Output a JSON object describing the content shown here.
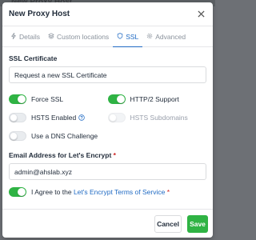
{
  "background": {
    "title_fragment": "New Proxy Host"
  },
  "modal": {
    "title": "New Proxy Host",
    "tabs": [
      {
        "label": "Details",
        "icon": "zap-icon",
        "active": false
      },
      {
        "label": "Custom locations",
        "icon": "layers-icon",
        "active": false
      },
      {
        "label": "SSL",
        "icon": "shield-icon",
        "active": true
      },
      {
        "label": "Advanced",
        "icon": "gear-icon",
        "active": false
      }
    ],
    "ssl_certificate": {
      "label": "SSL Certificate",
      "selected": "Request a new SSL Certificate"
    },
    "toggles": {
      "force_ssl": {
        "label": "Force SSL",
        "on": true
      },
      "http2": {
        "label": "HTTP/2 Support",
        "on": true
      },
      "hsts": {
        "label": "HSTS Enabled",
        "on": false
      },
      "hsts_subdomains": {
        "label": "HSTS Subdomains",
        "on": false,
        "disabled": true
      },
      "dns_challenge": {
        "label": "Use a DNS Challenge",
        "on": false
      }
    },
    "email": {
      "label": "Email Address for Let's Encrypt",
      "required_mark": "*",
      "value": "admin@ahslab.xyz"
    },
    "agree": {
      "prefix": "I Agree to the",
      "link": "Let's Encrypt Terms of Service",
      "required_mark": "*",
      "on": true
    },
    "buttons": {
      "cancel": "Cancel",
      "save": "Save"
    }
  },
  "colors": {
    "accent": "#206bc4",
    "success": "#2fb344",
    "required": "#cd201f"
  }
}
